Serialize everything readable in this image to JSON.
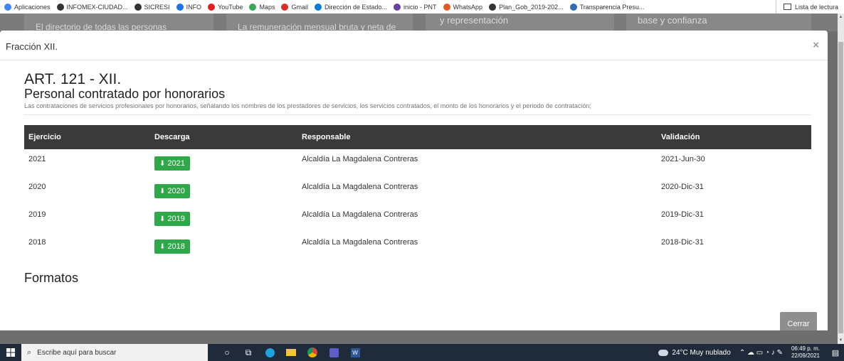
{
  "bookmarks": [
    {
      "label": "Aplicaciones",
      "color": "#4285f4"
    },
    {
      "label": "INFOMEX-CIUDAD...",
      "color": "#333333"
    },
    {
      "label": "SICRESI",
      "color": "#333333"
    },
    {
      "label": "INFO",
      "color": "#1a73e8"
    },
    {
      "label": "YouTube",
      "color": "#e02020"
    },
    {
      "label": "Maps",
      "color": "#34a853"
    },
    {
      "label": "Gmail",
      "color": "#d93025"
    },
    {
      "label": "Dirección de Estado...",
      "color": "#0a7bd6"
    },
    {
      "label": "inicio - PNT",
      "color": "#6b3fa0"
    },
    {
      "label": "WhatsApp",
      "color": "#e35b1f"
    },
    {
      "label": "Plan_Gob_2019-202...",
      "color": "#333333"
    },
    {
      "label": "Transparencia Presu...",
      "color": "#2e6db4"
    }
  ],
  "reading_list": "Lista de lectura",
  "background_tiles": [
    "El directorio de todas las personas",
    "La remuneración mensual bruta y neta de",
    "y representación",
    "base y confianza"
  ],
  "modal": {
    "title": "Fracción XII.",
    "close_icon": "×",
    "art_title": "ART. 121 - XII.",
    "subtitle": "Personal contratado por honorarios",
    "description": "Las contrataciones de servicios profesionales por honorarios, señalando los nombres de los prestadores de servicios, los servicios contratados, el monto de los honorarios y el periodo de contratación;",
    "headers": [
      "Ejercicio",
      "Descarga",
      "Responsable",
      "Validación"
    ],
    "rows": [
      {
        "year": "2021",
        "download": "2021",
        "responsible": "Alcaldía La Magdalena Contreras",
        "validation": "2021-Jun-30"
      },
      {
        "year": "2020",
        "download": "2020",
        "responsible": "Alcaldía La Magdalena Contreras",
        "validation": "2020-Dic-31"
      },
      {
        "year": "2019",
        "download": "2019",
        "responsible": "Alcaldía La Magdalena Contreras",
        "validation": "2019-Dic-31"
      },
      {
        "year": "2018",
        "download": "2018",
        "responsible": "Alcaldía La Magdalena Contreras",
        "validation": "2018-Dic-31"
      }
    ],
    "formats_title": "Formatos",
    "close_button": "Cerrar"
  },
  "taskbar": {
    "search_placeholder": "Escribe aquí para buscar",
    "weather": "24°C  Muy nublado",
    "time": "06:49 p. m.",
    "date": "22/09/2021"
  },
  "colors": {
    "download_button": "#2ea848",
    "table_header": "#3a3a3a",
    "taskbar": "#1f2a3a"
  }
}
